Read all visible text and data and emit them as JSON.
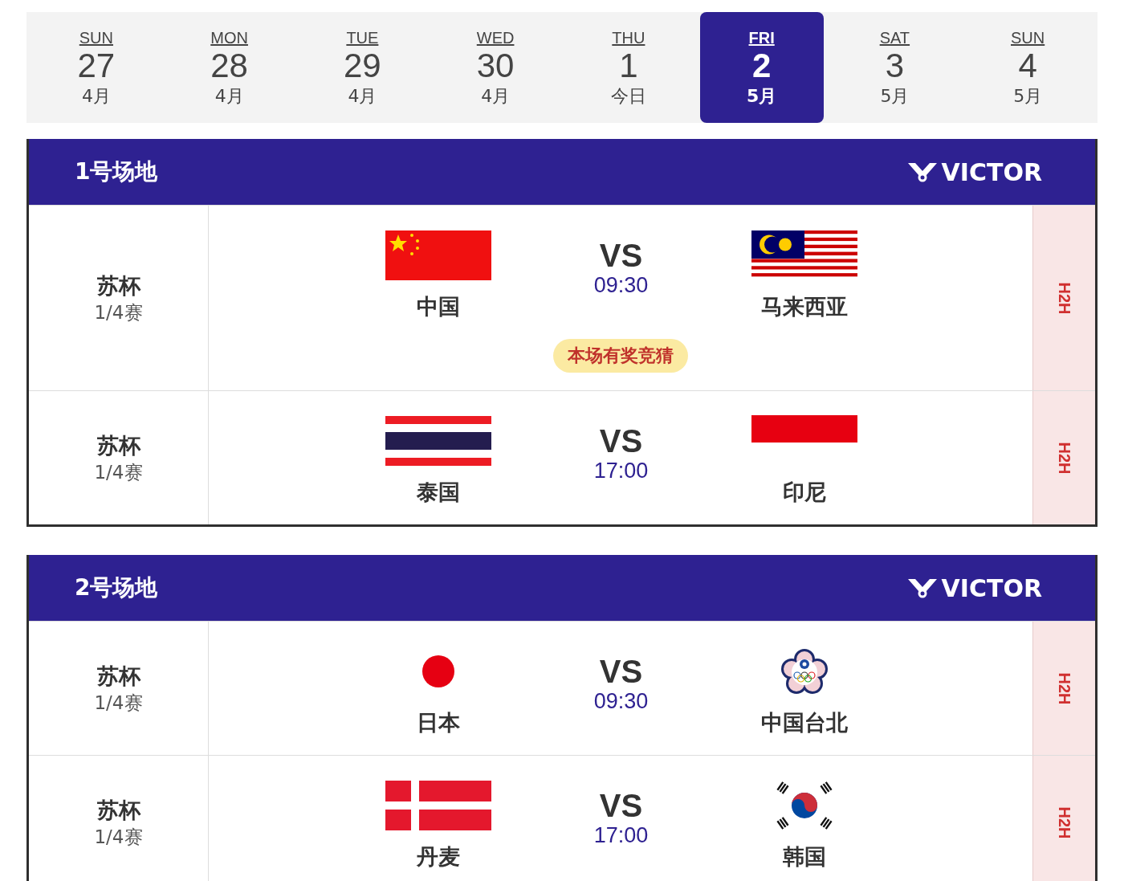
{
  "dates": [
    {
      "weekday": "SUN",
      "day": "27",
      "month": "4月",
      "selected": false
    },
    {
      "weekday": "MON",
      "day": "28",
      "month": "4月",
      "selected": false
    },
    {
      "weekday": "TUE",
      "day": "29",
      "month": "4月",
      "selected": false
    },
    {
      "weekday": "WED",
      "day": "30",
      "month": "4月",
      "selected": false
    },
    {
      "weekday": "THU",
      "day": "1",
      "month": "今日",
      "selected": false
    },
    {
      "weekday": "FRI",
      "day": "2",
      "month": "5月",
      "selected": true
    },
    {
      "weekday": "SAT",
      "day": "3",
      "month": "5月",
      "selected": false
    },
    {
      "weekday": "SUN",
      "day": "4",
      "month": "5月",
      "selected": false
    }
  ],
  "courts": [
    {
      "title": "1号场地",
      "logo": "VICTOR",
      "matches": [
        {
          "event": "苏杯",
          "round": "1/4赛",
          "team1": {
            "name": "中国",
            "kind": "china"
          },
          "vs": "VS",
          "time": "09:30",
          "team2": {
            "name": "马来西亚",
            "kind": "malaysia"
          },
          "badge": "本场有奖竞猜",
          "h2h": "H2H"
        },
        {
          "event": "苏杯",
          "round": "1/4赛",
          "team1": {
            "name": "泰国",
            "kind": "thailand"
          },
          "vs": "VS",
          "time": "17:00",
          "team2": {
            "name": "印尼",
            "kind": "indonesia"
          },
          "h2h": "H2H"
        }
      ]
    },
    {
      "title": "2号场地",
      "logo": "VICTOR",
      "matches": [
        {
          "event": "苏杯",
          "round": "1/4赛",
          "team1": {
            "name": "日本",
            "kind": "japan"
          },
          "vs": "VS",
          "time": "09:30",
          "team2": {
            "name": "中国台北",
            "kind": "chinese-taipei"
          },
          "h2h": "H2H"
        },
        {
          "event": "苏杯",
          "round": "1/4赛",
          "team1": {
            "name": "丹麦",
            "kind": "denmark"
          },
          "vs": "VS",
          "time": "17:00",
          "team2": {
            "name": "韩国",
            "kind": "korea"
          },
          "h2h": "H2H"
        }
      ]
    }
  ]
}
